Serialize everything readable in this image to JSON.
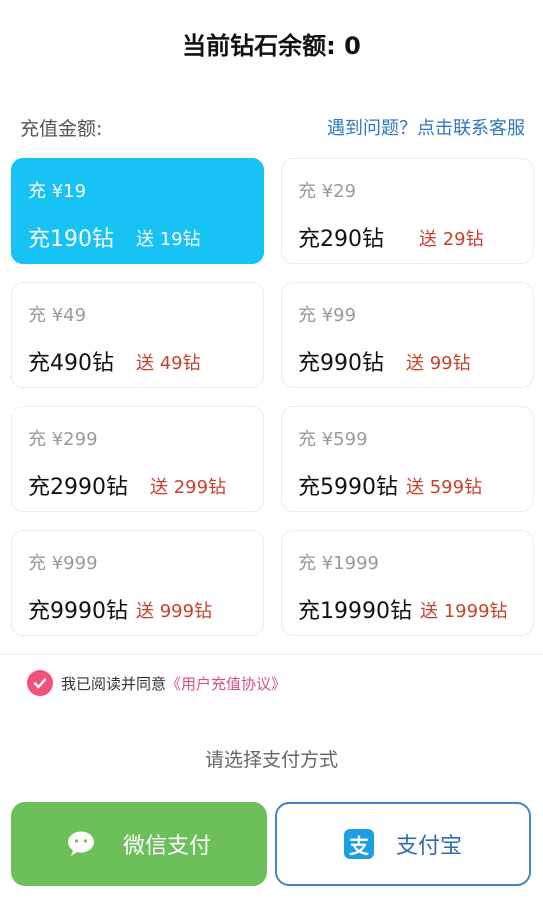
{
  "header": {
    "balance_title": "当前钻石余额: 0"
  },
  "recharge": {
    "label": "充值金额:",
    "help_link": "遇到问题？点击联系客服",
    "options": [
      {
        "price": "充 ¥19",
        "amount": "充190钻",
        "bonus": "送 19钻",
        "selected": true
      },
      {
        "price": "充 ¥29",
        "amount": "充290钻",
        "bonus": "送 29钻",
        "selected": false
      },
      {
        "price": "充 ¥49",
        "amount": "充490钻",
        "bonus": "送 49钻",
        "selected": false
      },
      {
        "price": "充 ¥99",
        "amount": "充990钻",
        "bonus": "送 99钻",
        "selected": false
      },
      {
        "price": "充 ¥299",
        "amount": "充2990钻",
        "bonus": "送 299钻",
        "selected": false
      },
      {
        "price": "充 ¥599",
        "amount": "充5990钻",
        "bonus": "送 599钻",
        "selected": false
      },
      {
        "price": "充 ¥999",
        "amount": "充9990钻",
        "bonus": "送 999钻",
        "selected": false
      },
      {
        "price": "充 ¥1999",
        "amount": "充19990钻",
        "bonus": "送 1999钻",
        "selected": false
      }
    ]
  },
  "agreement": {
    "text": "我已阅读并同意",
    "link": "《用户充值协议》",
    "checked": true
  },
  "payment": {
    "prompt": "请选择支付方式",
    "wechat_label": "微信支付",
    "alipay_label": "支付宝"
  },
  "colors": {
    "accent": "#17c2f5",
    "bonus_red": "#c8412c",
    "wechat_green": "#6dbf5a",
    "alipay_blue": "#3f86c9",
    "check_pink": "#f0527e"
  },
  "icons": {
    "check": "check-icon",
    "wechat": "wechat-icon",
    "alipay": "alipay-icon"
  }
}
